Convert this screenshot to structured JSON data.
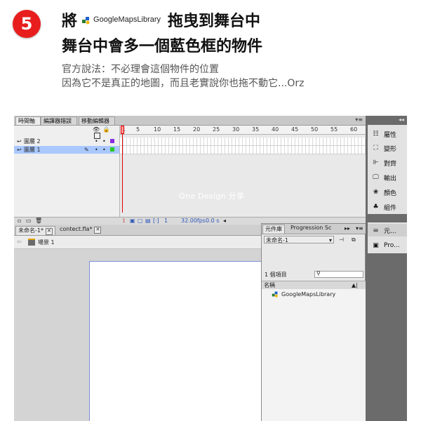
{
  "step": {
    "number": "5"
  },
  "heading": {
    "prefix": "將",
    "library_name": "GoogleMapsLibrary",
    "suffix": "拖曳到舞台中",
    "line2": "舞台中會多一個藍色框的物件"
  },
  "description": {
    "line1": "官方說法：不必理會這個物件的位置",
    "line2": "因為它不是真正的地圖，而且老實說你也拖不動它...Orz"
  },
  "timeline_tabs": [
    "時間軸",
    "編譯器錯誤",
    "移動編輯器"
  ],
  "timeline": {
    "layers": [
      {
        "name": "圖層 2",
        "color": "#8a2be2",
        "selected": false
      },
      {
        "name": "圖層 1",
        "color": "#28c828",
        "selected": true
      }
    ],
    "ruler_ticks": [
      "1",
      "5",
      "10",
      "15",
      "20",
      "25",
      "30",
      "35",
      "40",
      "45",
      "50",
      "55",
      "60"
    ],
    "current_frame": "1",
    "fps": "32.00",
    "fps_unit": "fps",
    "time": "0.0",
    "time_unit": "s",
    "watermark": "One Design 分享"
  },
  "doc_tabs": [
    {
      "label": "未命名-1*"
    },
    {
      "label": "contect.fla*"
    }
  ],
  "scene": {
    "label": "場景 1"
  },
  "library_panel": {
    "tabs": [
      "元件庫",
      "Progression Sc"
    ],
    "document": "未命名-1",
    "item_count": "1 個項目",
    "column_name": "名稱",
    "items": [
      {
        "name": "GoogleMapsLibrary"
      }
    ]
  },
  "dock": {
    "buttons": [
      "屬性",
      "變形",
      "對齊",
      "輸出",
      "顏色",
      "組件"
    ],
    "buttons2": [
      "元...",
      "Pro..."
    ]
  },
  "colors": {
    "badge": "#e81e1e",
    "selected_layer": "#a9c8ff",
    "playhead": "#e00000",
    "stage_border": "#7d8fd6"
  }
}
